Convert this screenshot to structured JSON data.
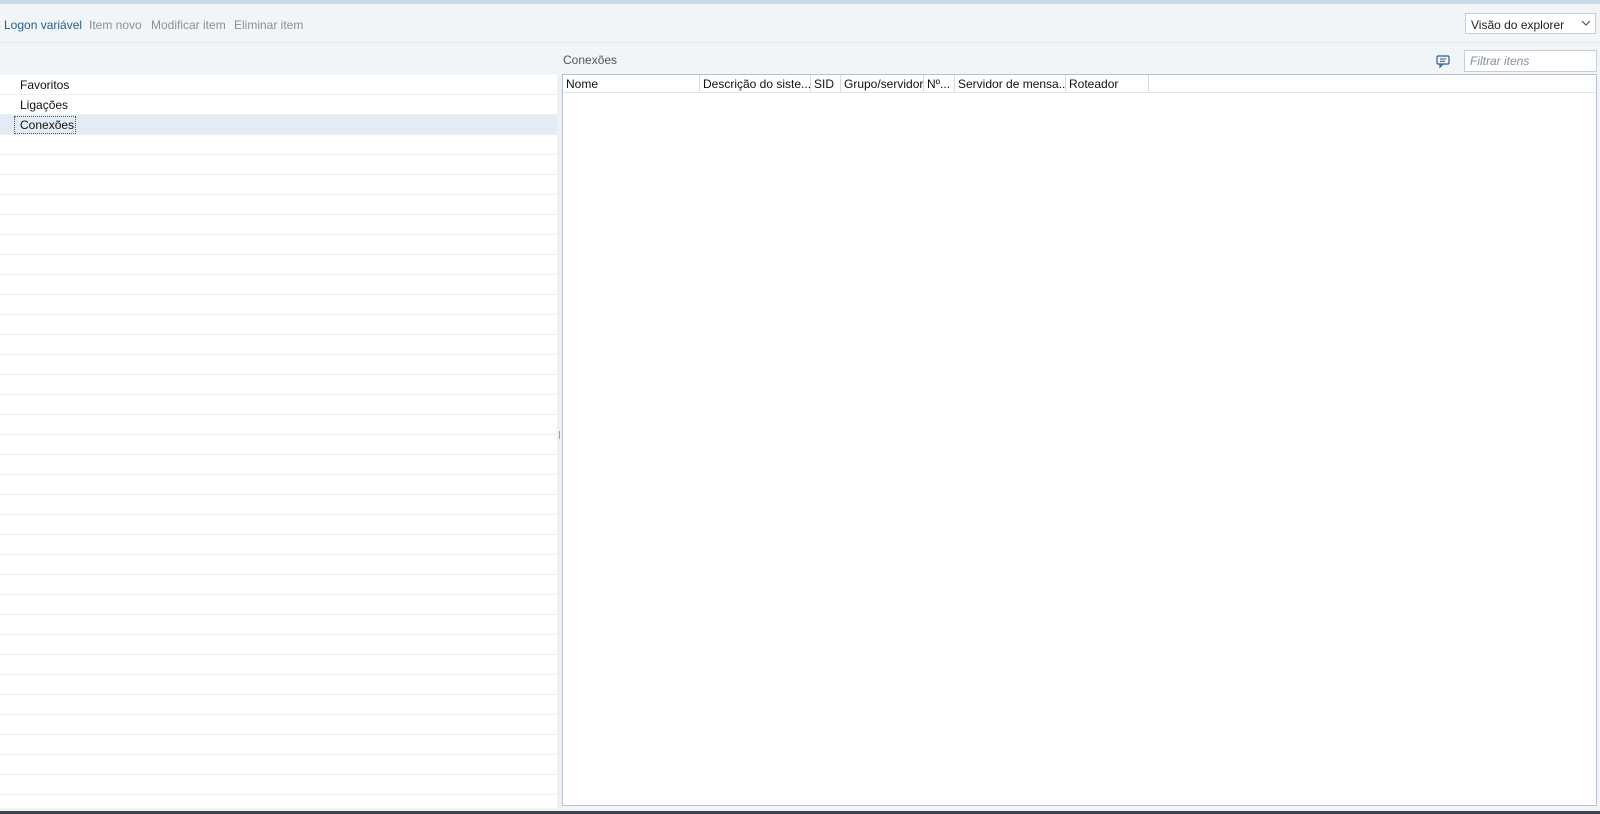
{
  "toolbar": {
    "items": [
      {
        "label": "Logon variável",
        "enabled": true
      },
      {
        "label": "Item novo",
        "enabled": false
      },
      {
        "label": "Modificar item",
        "enabled": false
      },
      {
        "label": "Eliminar item",
        "enabled": false
      }
    ],
    "view_select": {
      "value": "Visão do explorer",
      "icon": "chevron-down-icon"
    }
  },
  "tree": {
    "items": [
      {
        "label": "Favoritos",
        "selected": false
      },
      {
        "label": "Ligações",
        "selected": false
      },
      {
        "label": "Conexões",
        "selected": true
      }
    ]
  },
  "content": {
    "title": "Conexões",
    "filter_placeholder": "Filtrar itens",
    "filter_icon": "comment-icon",
    "columns": [
      "Nome",
      "Descrição do siste...",
      "SID",
      "Grupo/servidor",
      "Nº...",
      "Servidor de mensa...",
      "Roteador"
    ],
    "rows": []
  },
  "colors": {
    "accent": "#2a5d8f",
    "disabled_text": "#8a8f96",
    "selection": "#e3ebf4"
  }
}
